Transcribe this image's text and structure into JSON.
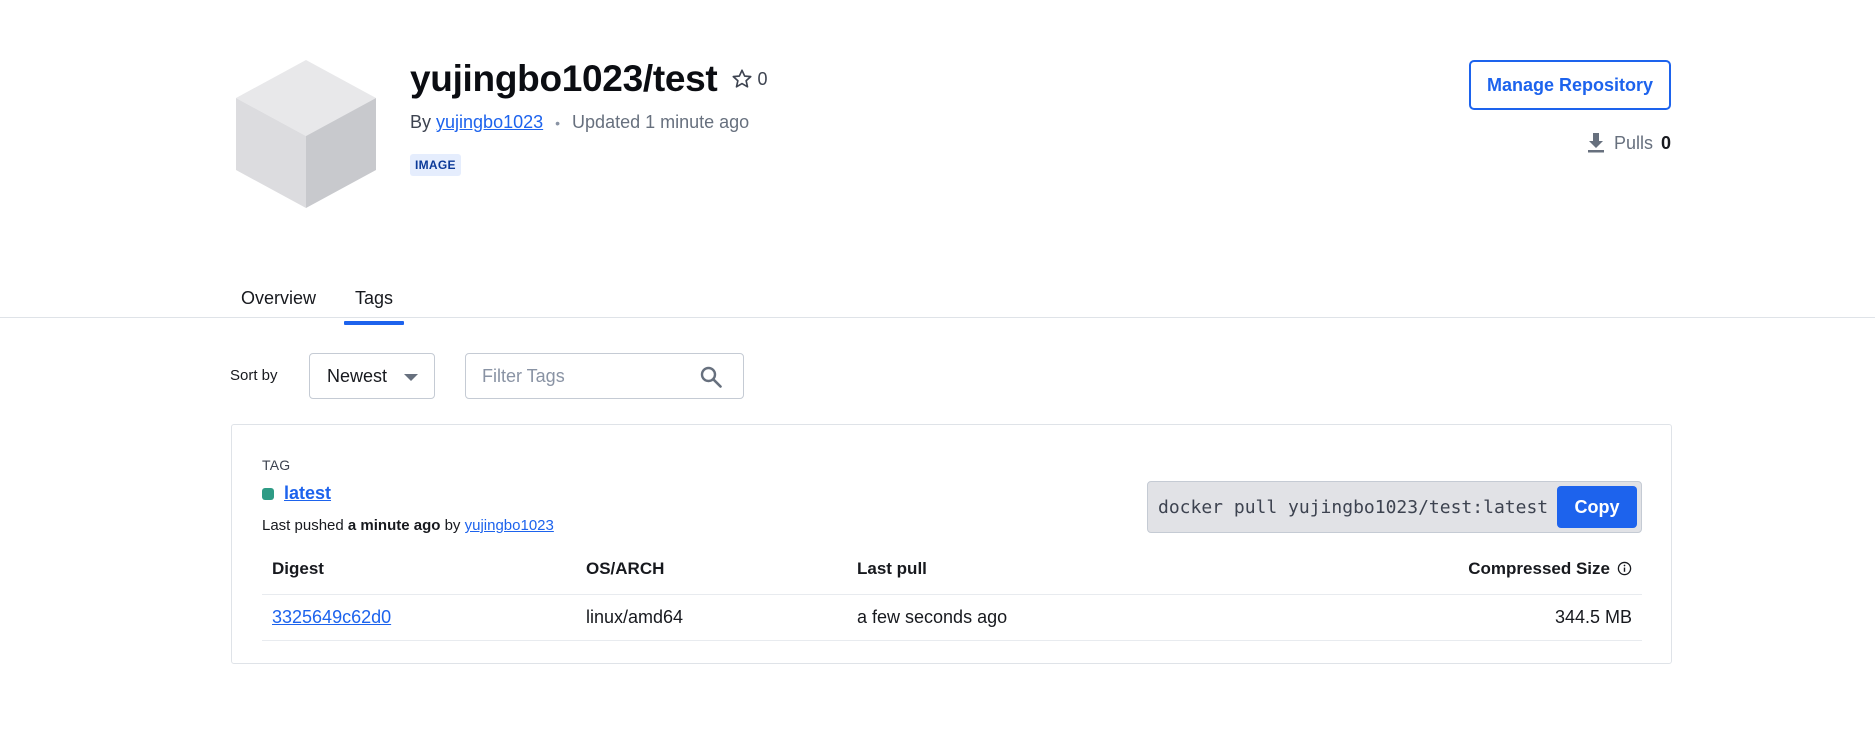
{
  "repo": {
    "title": "yujingbo1023/test",
    "star_count": "0",
    "by_prefix": "By",
    "owner": "yujingbo1023",
    "updated": "Updated 1 minute ago",
    "badge": "IMAGE",
    "manage_label": "Manage Repository",
    "pulls_label": "Pulls",
    "pulls_count": "0"
  },
  "tabs": [
    {
      "label": "Overview",
      "active": false
    },
    {
      "label": "Tags",
      "active": true
    }
  ],
  "controls": {
    "sort_label": "Sort by",
    "sort_value": "Newest",
    "filter_placeholder": "Filter Tags"
  },
  "tag": {
    "section_label": "TAG",
    "name": "latest",
    "pushed_prefix": "Last pushed",
    "pushed_time": "a minute ago",
    "pushed_by": "by",
    "pushed_user": "yujingbo1023",
    "pull_command": "docker pull yujingbo1023/test:latest",
    "copy_label": "Copy",
    "status_color": "#2e9b85"
  },
  "table": {
    "headers": [
      "Digest",
      "OS/ARCH",
      "Last pull",
      "Compressed Size"
    ],
    "rows": [
      {
        "digest": "3325649c62d0",
        "os_arch": "linux/amd64",
        "last_pull": "a few seconds ago",
        "size": "344.5 MB"
      }
    ]
  },
  "colors": {
    "accent": "#1d63ed",
    "badge_bg": "#e5edfd"
  }
}
